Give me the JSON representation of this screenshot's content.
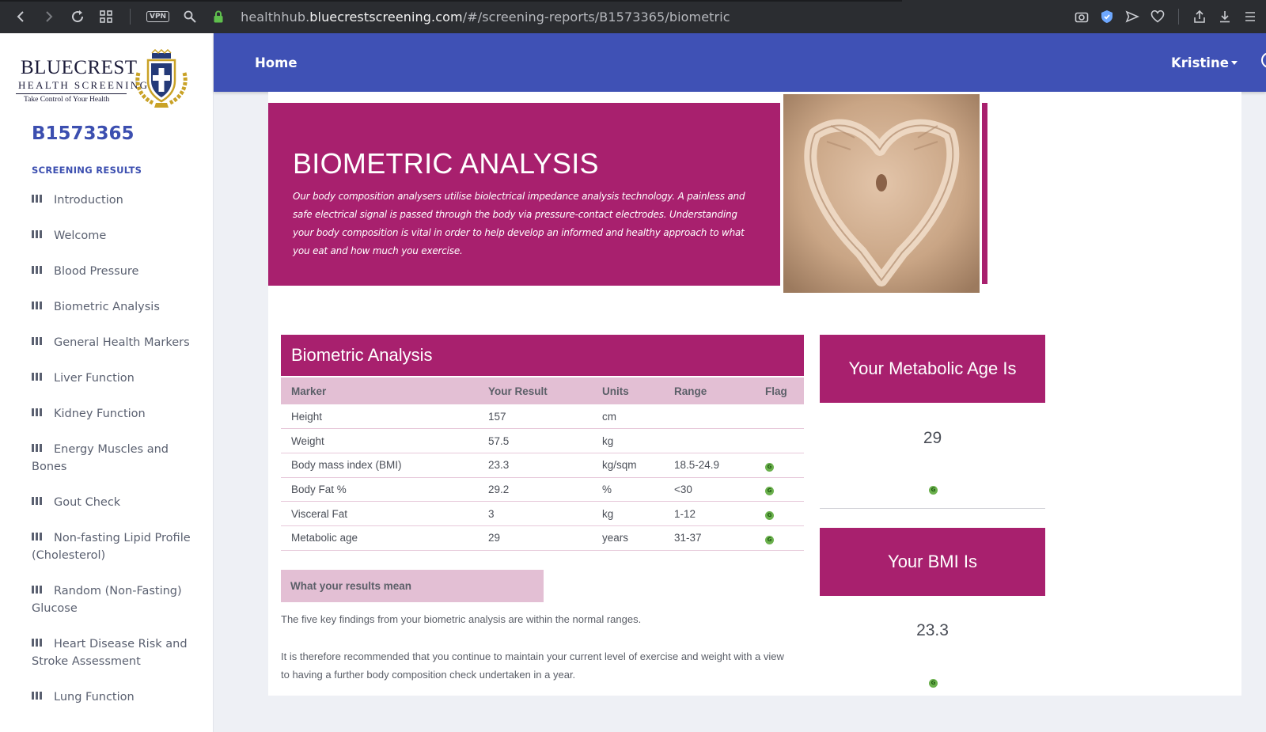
{
  "browser": {
    "url_prefix": "healthhub.",
    "url_domain": "bluecrestscreening.com",
    "url_path": "/#/screening-reports/B1573365/biometric",
    "vpn_label": "VPN"
  },
  "sidebar": {
    "logo": {
      "line1": "BLUECREST",
      "line2": "HEALTH SCREENING",
      "tagline": "Take Control of Your Health"
    },
    "report_id": "B1573365",
    "section_title": "SCREENING RESULTS",
    "items": [
      {
        "label": "Introduction"
      },
      {
        "label": "Welcome"
      },
      {
        "label": "Blood Pressure"
      },
      {
        "label": "Biometric Analysis"
      },
      {
        "label": "General Health Markers"
      },
      {
        "label": "Liver Function"
      },
      {
        "label": "Kidney Function"
      },
      {
        "label": "Energy Muscles and Bones"
      },
      {
        "label": "Gout Check"
      },
      {
        "label": "Non-fasting Lipid Profile (Cholesterol)"
      },
      {
        "label": "Random (Non-Fasting) Glucose"
      },
      {
        "label": "Heart Disease Risk and Stroke Assessment"
      },
      {
        "label": "Lung Function"
      }
    ]
  },
  "header": {
    "home_label": "Home",
    "user_label": "Kristine"
  },
  "hero": {
    "title": "BIOMETRIC ANALYSIS",
    "description": "Our body composition analysers utilise biolectrical impedance analysis technology. A painless and safe electrical signal is passed through the body via pressure-contact electrodes. Understanding your body composition is vital in order to help develop an informed and healthy approach to what you eat and how much you exercise."
  },
  "table": {
    "title": "Biometric Analysis",
    "columns": [
      "Marker",
      "Your Result",
      "Units",
      "Range",
      "Flag"
    ],
    "rows": [
      {
        "marker": "Height",
        "result": "157",
        "units": "cm",
        "range": "",
        "flag": ""
      },
      {
        "marker": "Weight",
        "result": "57.5",
        "units": "kg",
        "range": "",
        "flag": ""
      },
      {
        "marker": "Body mass index (BMI)",
        "result": "23.3",
        "units": "kg/sqm",
        "range": "18.5-24.9",
        "flag": "G"
      },
      {
        "marker": "Body Fat %",
        "result": "29.2",
        "units": "%",
        "range": "<30",
        "flag": "G"
      },
      {
        "marker": "Visceral Fat",
        "result": "3",
        "units": "kg",
        "range": "1-12",
        "flag": "G"
      },
      {
        "marker": "Metabolic age",
        "result": "29",
        "units": "years",
        "range": "31-37",
        "flag": "G"
      }
    ]
  },
  "results_mean": {
    "heading": "What your results mean",
    "paragraph1": "The five key findings from your biometric analysis are within the normal ranges.",
    "paragraph2": "It is therefore recommended that you continue to maintain your current level of exercise and weight with a view to having a further body composition check undertaken in a year."
  },
  "metabolic_card": {
    "title": "Your Metabolic Age Is",
    "value": "29",
    "flag": "G"
  },
  "bmi_card": {
    "title": "Your BMI Is",
    "value": "23.3",
    "flag": "G"
  },
  "colors": {
    "brand_blue": "#3f51b5",
    "accent_magenta": "#a8206e",
    "table_header_pink": "#e3bfd4",
    "flag_green": "#6ab04c"
  }
}
